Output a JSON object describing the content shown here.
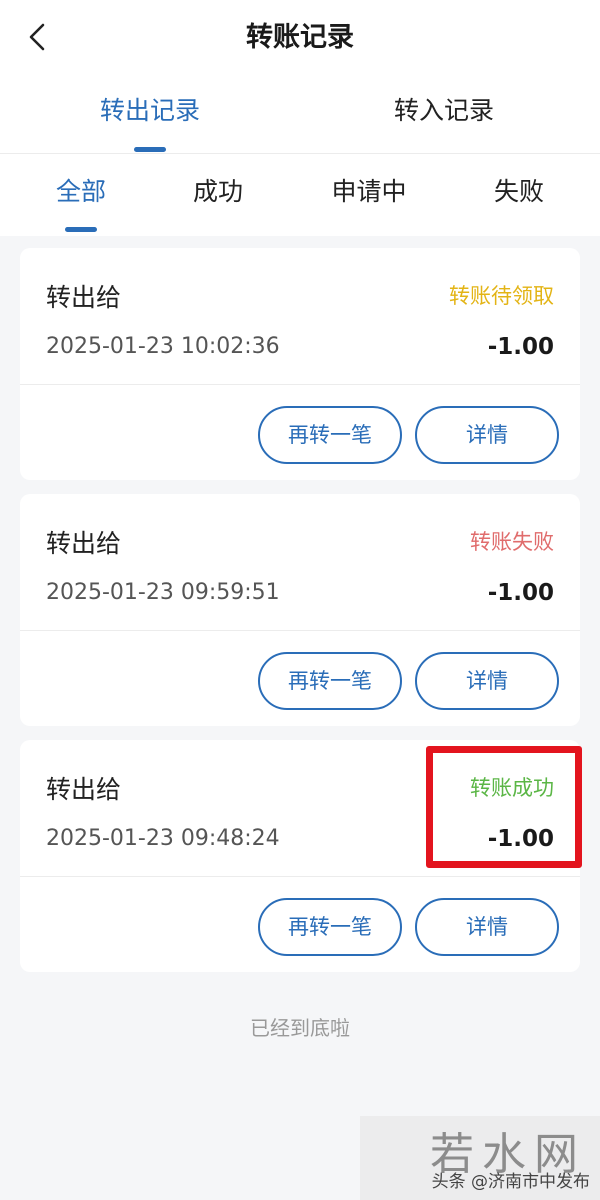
{
  "header": {
    "title": "转账记录"
  },
  "main_tabs": [
    {
      "label": "转出记录",
      "active": true
    },
    {
      "label": "转入记录",
      "active": false
    }
  ],
  "filter_tabs": [
    {
      "label": "全部",
      "active": true
    },
    {
      "label": "成功",
      "active": false
    },
    {
      "label": "申请中",
      "active": false
    },
    {
      "label": "失败",
      "active": false
    }
  ],
  "records": [
    {
      "title": "转出给",
      "status": "转账待领取",
      "status_color": "#e3b415",
      "time": "2025-01-23 10:02:36",
      "amount": "-1.00"
    },
    {
      "title": "转出给",
      "status": "转账失败",
      "status_color": "#e06c6c",
      "time": "2025-01-23 09:59:51",
      "amount": "-1.00"
    },
    {
      "title": "转出给",
      "status": "转账成功",
      "status_color": "#5bb646",
      "time": "2025-01-23 09:48:24",
      "amount": "-1.00"
    }
  ],
  "buttons": {
    "again": "再转一笔",
    "detail": "详情"
  },
  "end_text": "已经到底啦",
  "watermark": {
    "logo": "若水网",
    "text": "头条 @济南市中发布"
  },
  "colors": {
    "accent": "#2a6db8",
    "highlight": "#e3141e"
  }
}
